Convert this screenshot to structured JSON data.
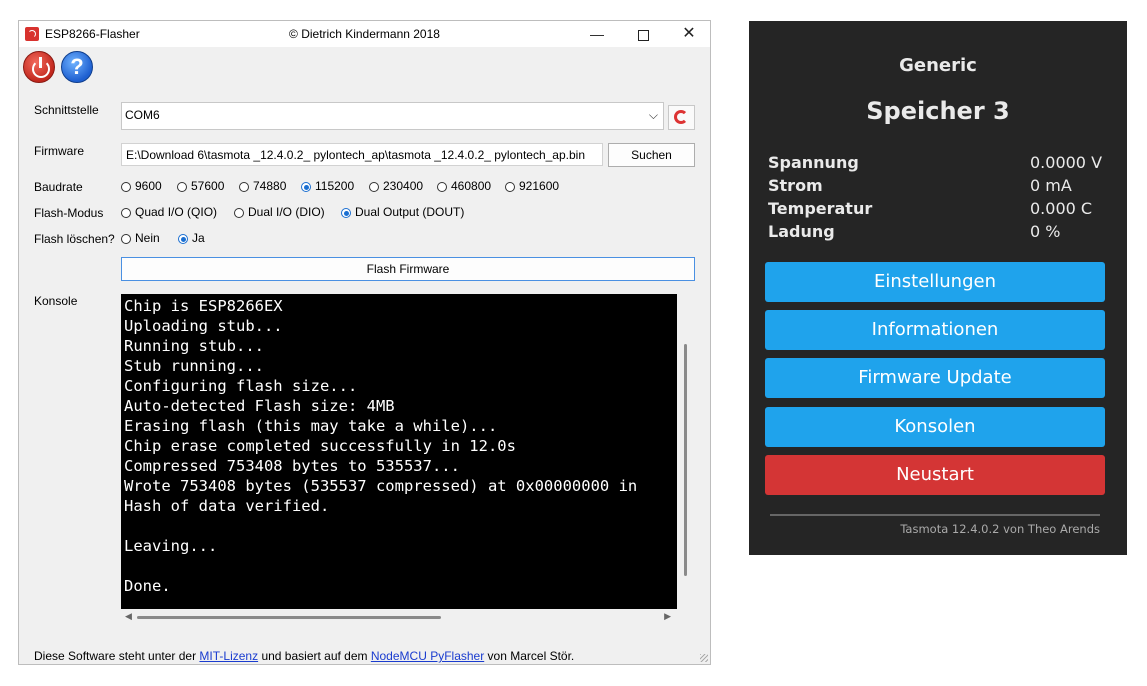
{
  "window": {
    "title": "ESP8266-Flasher",
    "copyright": "© Dietrich Kindermann 2018",
    "min_glyph": "—",
    "close_glyph": "✕"
  },
  "toolbar": {
    "help_glyph": "?"
  },
  "labels": {
    "port": "Schnittstelle",
    "firmware": "Firmware",
    "baudrate": "Baudrate",
    "flash_mode": "Flash-Modus",
    "erase": "Flash löschen?",
    "console": "Konsole"
  },
  "port": {
    "value": "COM6",
    "arrow": "⌵"
  },
  "firmware": {
    "path": "E:\\Download 6\\tasmota _12.4.0.2_ pylontech_ap\\tasmota _12.4.0.2_ pylontech_ap.bin",
    "browse_label": "Suchen"
  },
  "baudrates": [
    {
      "label": "9600",
      "selected": false
    },
    {
      "label": "57600",
      "selected": false
    },
    {
      "label": "74880",
      "selected": false
    },
    {
      "label": "115200",
      "selected": true
    },
    {
      "label": "230400",
      "selected": false
    },
    {
      "label": "460800",
      "selected": false
    },
    {
      "label": "921600",
      "selected": false
    }
  ],
  "flash_modes": [
    {
      "label": "Quad I/O (QIO)",
      "selected": false
    },
    {
      "label": "Dual I/O (DIO)",
      "selected": false
    },
    {
      "label": "Dual Output (DOUT)",
      "selected": true
    }
  ],
  "erase_options": [
    {
      "label": "Nein",
      "selected": false
    },
    {
      "label": "Ja",
      "selected": true
    }
  ],
  "flash_button": "Flash Firmware",
  "console_text": "Chip is ESP8266EX\nUploading stub...\nRunning stub...\nStub running...\nConfiguring flash size...\nAuto-detected Flash size: 4MB\nErasing flash (this may take a while)...\nChip erase completed successfully in 12.0s\nCompressed 753408 bytes to 535537...\nWrote 753408 bytes (535537 compressed) at 0x00000000 in\nHash of data verified.\n\nLeaving...\n\nDone.",
  "scroll": {
    "left": "◀",
    "right": "▶"
  },
  "footer": {
    "t1": "Diese Software steht unter der ",
    "link1": "MIT-Lizenz",
    "t2": " und basiert auf dem ",
    "link2": "NodeMCU PyFlasher",
    "t3": " von Marcel Stör."
  },
  "tasmota": {
    "device": "Generic",
    "title": "Speicher 3",
    "rows": [
      {
        "label": "Spannung",
        "value": "0.0000 V"
      },
      {
        "label": "Strom",
        "value": "0 mA"
      },
      {
        "label": "Temperatur",
        "value": "0.000 C"
      },
      {
        "label": "Ladung",
        "value": "0 %"
      }
    ],
    "buttons": [
      "Einstellungen",
      "Informationen",
      "Firmware Update",
      "Konsolen",
      "Neustart"
    ],
    "footer": "Tasmota 12.4.0.2 von Theo Arends",
    "colors": {
      "background": "#252525",
      "button": "#1fa3ec",
      "restart": "#d43535"
    }
  }
}
